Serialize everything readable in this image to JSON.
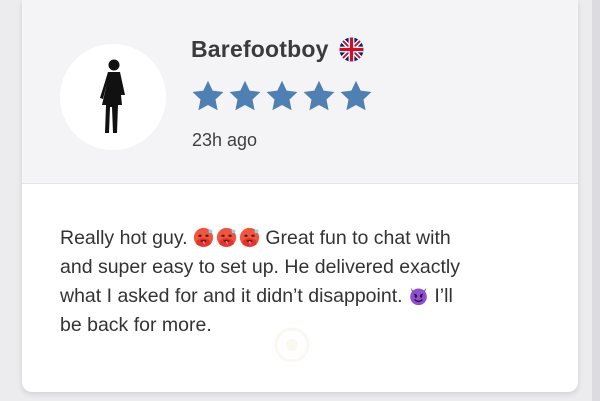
{
  "review": {
    "reviewer_name": "Barefootboy",
    "country_flag_icon": "uk-flag-icon",
    "rating": 5,
    "rating_max": 5,
    "star_color": "#4f7fb3",
    "timestamp": "23h ago",
    "avatar_icon": "person-silhouette-icon",
    "text_lines": [
      [
        "Really hot guy. ",
        "Great fun to chat with"
      ],
      [
        "and super easy to set up. He delivered exactly"
      ],
      [
        "what I asked for and it didn’t disappoint. ",
        "I’ll"
      ],
      [
        "be back for more."
      ]
    ],
    "emojis": {
      "line1": "hot-face-emoji",
      "line3": "smiling-devil-emoji"
    }
  }
}
